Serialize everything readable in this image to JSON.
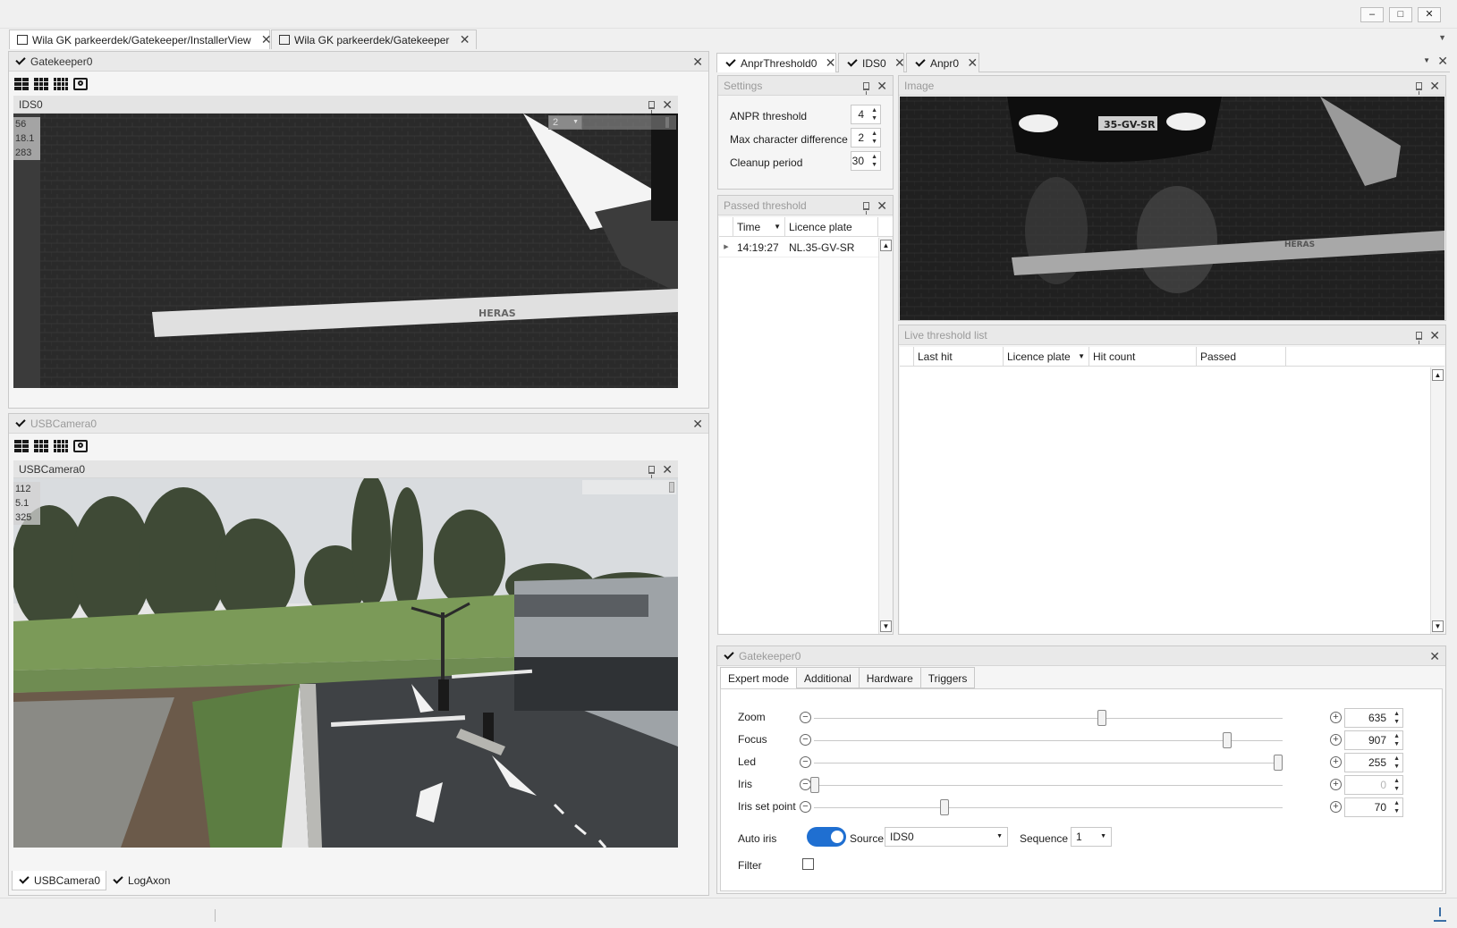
{
  "window": {
    "controls": [
      "–",
      "□",
      "✕"
    ]
  },
  "doc_tabs": [
    {
      "label": "Wila GK parkeerdek/Gatekeeper/InstallerView",
      "active": true
    },
    {
      "label": "Wila GK parkeerdek/Gatekeeper",
      "active": false
    }
  ],
  "left_top": {
    "title": "Gatekeeper0",
    "view_title": "IDS0",
    "overlay_stats": [
      "56",
      "18.1",
      "283"
    ],
    "dropdown_value": "2"
  },
  "left_bottom": {
    "title": "USBCamera0",
    "view_title": "USBCamera0",
    "overlay_stats": [
      "112",
      "5.1",
      "325"
    ],
    "bottom_tabs": [
      "USBCamera0",
      "LogAxon"
    ]
  },
  "right_tabs": [
    {
      "label": "AnprThreshold0",
      "active": true
    },
    {
      "label": "IDS0",
      "active": false
    },
    {
      "label": "Anpr0",
      "active": false
    }
  ],
  "settings": {
    "title": "Settings",
    "rows": [
      {
        "label": "ANPR threshold",
        "value": "4"
      },
      {
        "label": "Max character difference",
        "value": "2"
      },
      {
        "label": "Cleanup period",
        "value": "30"
      }
    ]
  },
  "image_panel": {
    "title": "Image",
    "plate_text": "35-GV-SR",
    "barrier_brand": "HERAS"
  },
  "passed_threshold": {
    "title": "Passed threshold",
    "columns": [
      "Time",
      "Licence plate"
    ],
    "rows": [
      {
        "time": "14:19:27",
        "plate": "NL.35-GV-SR"
      }
    ]
  },
  "live_threshold": {
    "title": "Live threshold list",
    "columns": [
      "Last hit",
      "Licence plate",
      "Hit count",
      "Passed"
    ]
  },
  "gatekeeper_panel": {
    "title": "Gatekeeper0",
    "tabs": [
      "Expert mode",
      "Additional",
      "Hardware",
      "Triggers"
    ],
    "sliders": [
      {
        "label": "Zoom",
        "value": "635",
        "fraction": 0.62,
        "disabled": false
      },
      {
        "label": "Focus",
        "value": "907",
        "fraction": 0.89,
        "disabled": false
      },
      {
        "label": "Led",
        "value": "255",
        "fraction": 1.0,
        "disabled": false
      },
      {
        "label": "Iris",
        "value": "0",
        "fraction": 0.0,
        "disabled": true
      },
      {
        "label": "Iris set point",
        "value": "70",
        "fraction": 0.28,
        "disabled": false
      }
    ],
    "auto_iris_label": "Auto iris",
    "auto_iris_on": true,
    "source_label": "Source",
    "source_value": "IDS0",
    "sequence_label": "Sequence",
    "sequence_value": "1",
    "filter_label": "Filter"
  },
  "camera_scene": {
    "barrier_brand": "HERAS"
  },
  "colors": {
    "accent": "#1f6fd1",
    "panel_bg": "#f5f5f5",
    "header_bg": "#e9e9e9"
  }
}
